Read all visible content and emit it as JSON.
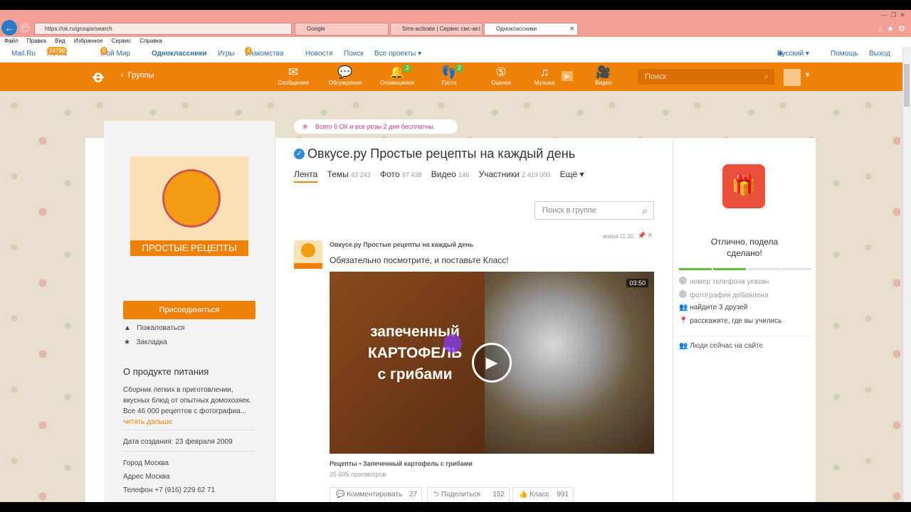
{
  "browser": {
    "url": "https://ok.ru/groups/search",
    "tabs": [
      {
        "label": "Google",
        "active": false
      },
      {
        "label": "Sms-activate | Сервис смс-акт...",
        "active": false
      },
      {
        "label": "Одноклассники",
        "active": true
      }
    ],
    "menu": [
      "Файл",
      "Правка",
      "Вид",
      "Избранное",
      "Сервис",
      "Справка"
    ]
  },
  "portal": {
    "items": [
      "Mail.Ru",
      "Почта",
      "Мой Мир",
      "Одноклассники",
      "Игры",
      "Знакомства",
      "Новости",
      "Поиск",
      "Все проекты ▾"
    ],
    "mail_badge": "24799",
    "myworld_badge": "6",
    "dating_badge": "4",
    "language": "Русский ▾",
    "help": "Помощь",
    "logout": "Выход"
  },
  "header": {
    "breadcrumb": "Группы",
    "nav": [
      {
        "label": "Сообщения",
        "icon": "envelope-icon",
        "badge": ""
      },
      {
        "label": "Обсуждения",
        "icon": "chat-bubbles-icon",
        "badge": ""
      },
      {
        "label": "Оповещения",
        "icon": "bell-icon",
        "badge": "2"
      },
      {
        "label": "Гости",
        "icon": "footprints-icon",
        "badge": "2"
      },
      {
        "label": "Оценки",
        "icon": "rating-icon",
        "badge": ""
      },
      {
        "label": "Музыка",
        "icon": "music-note-icon",
        "badge": ""
      },
      {
        "label": "Видео",
        "icon": "video-camera-icon",
        "badge": ""
      }
    ],
    "search_placeholder": "Поиск"
  },
  "sidebar": {
    "logo_caption": "ПРОСТЫЕ РЕЦЕПТЫ",
    "join_label": "Присоединиться",
    "complain": "Пожаловаться",
    "bookmark": "Закладка",
    "about_title": "О продукте питания",
    "about_text": [
      "Сборник легких в приготовлении,",
      "вкусных блюд от опытных домохозяек.",
      "Все 46 000 рецептов с фотографиа..."
    ],
    "read_more": "читать дальше",
    "created": "Дата создания: 23 февраля 2009",
    "city": "Город Москва",
    "address": "Адрес Москва",
    "phone": "Телефон +7 (916) 229 62 71"
  },
  "group": {
    "promo": "Всего 6 ОК и все розы 2 дня бесплатны.",
    "title": "Овкусе.ру Простые рецепты на каждый день",
    "tabs": [
      {
        "label": "Лента",
        "count": ""
      },
      {
        "label": "Темы",
        "count": "43 243"
      },
      {
        "label": "Фото",
        "count": "97 438"
      },
      {
        "label": "Видео",
        "count": "146"
      },
      {
        "label": "Участники",
        "count": "2 419 000"
      },
      {
        "label": "Ещё ▾",
        "count": ""
      }
    ],
    "search_placeholder": "Поиск в группе"
  },
  "post": {
    "author": "Овкусе.ру Простые рецепты на каждый день",
    "time": "вчера 11:30",
    "text": "Обязательно посмотрите, и поставьте Класс!",
    "video_title_lines": [
      "запеченный",
      "КАРТОФЕЛЬ",
      "с грибами"
    ],
    "duration": "03:50",
    "caption": "Рецепты • Запеченный картофель с грибами",
    "views": "25 605 просмотров",
    "actions": [
      {
        "label": "Комментировать",
        "count": "27"
      },
      {
        "label": "Поделиться",
        "count": "152"
      },
      {
        "label": "Класс",
        "count": "991"
      }
    ]
  },
  "right": {
    "congrats": [
      "Отлично, подела",
      "сделано!"
    ],
    "checklist": [
      {
        "label": "номер телефона указан",
        "done": true
      },
      {
        "label": "фотография добавлена",
        "done": true
      },
      {
        "label": "найдите 3 друзей",
        "done": false
      },
      {
        "label": "расскажите, где вы учились",
        "done": false
      }
    ],
    "people_online": "Люди сейчас на сайте"
  },
  "colors": {
    "brand_orange": "#ee8208",
    "link_blue": "#2f6c9b",
    "badge_green": "#69b840"
  }
}
